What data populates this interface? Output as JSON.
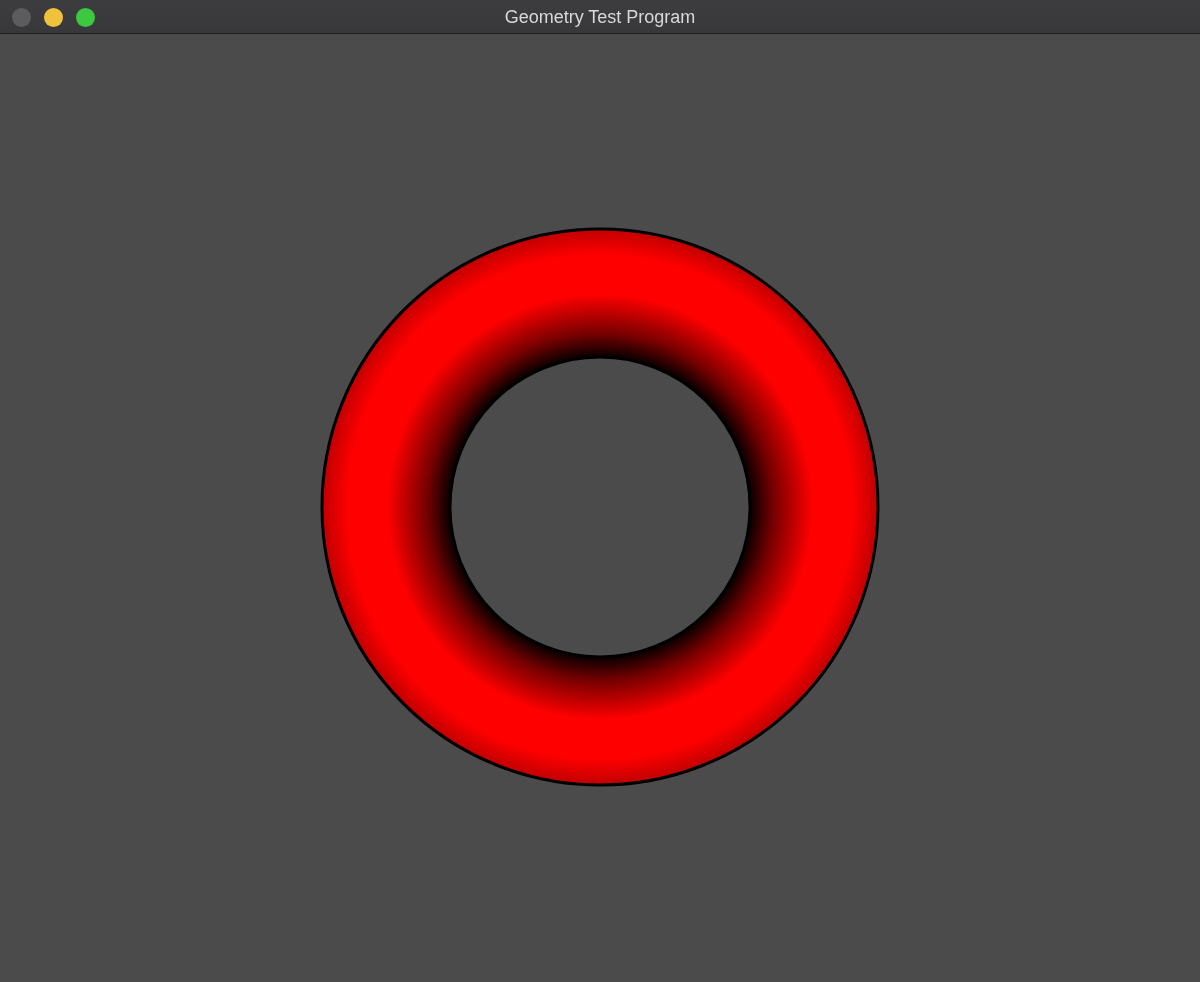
{
  "window": {
    "title": "Geometry Test Program"
  },
  "traffic_lights": [
    {
      "kind": "close",
      "disabled": true
    },
    {
      "kind": "minimize",
      "disabled": false
    },
    {
      "kind": "zoom",
      "disabled": false
    }
  ]
}
